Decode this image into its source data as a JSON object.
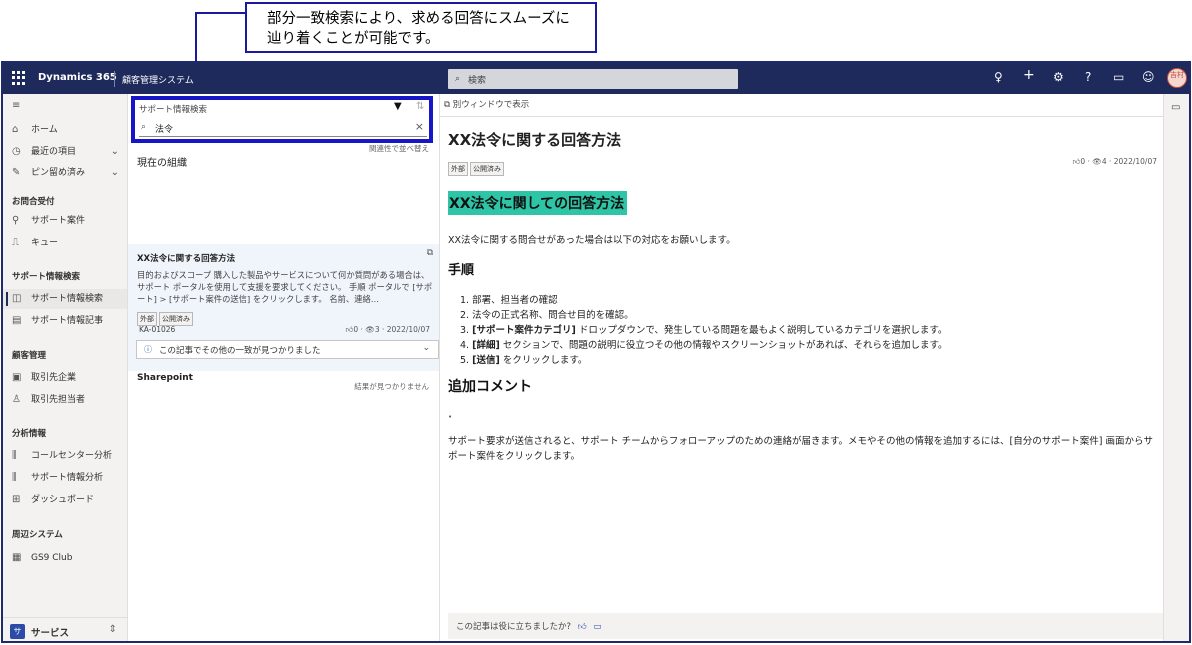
{
  "callout": {
    "line1": "部分一致検索により、求める回答にスムーズに",
    "line2": "辿り着くことが可能です。"
  },
  "topbar": {
    "brand": "Dynamics 365",
    "app_name": "顧客管理システム",
    "search_placeholder": "検索",
    "icons": [
      "lightbulb-icon",
      "plus-icon",
      "settings-icon",
      "help-icon",
      "chat-icon",
      "smiley-icon"
    ],
    "avatar_text": "吉村"
  },
  "sidebar": {
    "top_items": [
      {
        "label": "ホーム",
        "icon": "home-icon"
      },
      {
        "label": "最近の項目",
        "icon": "clock-icon"
      },
      {
        "label": "ピン留め済み",
        "icon": "pin-icon"
      }
    ],
    "groups": [
      {
        "title": "お問合受付",
        "items": [
          {
            "label": "サポート案件"
          },
          {
            "label": "キュー"
          }
        ]
      },
      {
        "title": "サポート情報検索",
        "items": [
          {
            "label": "サポート情報検索"
          },
          {
            "label": "サポート情報記事"
          }
        ]
      },
      {
        "title": "顧客管理",
        "items": [
          {
            "label": "取引先企業"
          },
          {
            "label": "取引先担当者"
          }
        ]
      },
      {
        "title": "分析情報",
        "items": [
          {
            "label": "コールセンター分析"
          },
          {
            "label": "サポート情報分析"
          },
          {
            "label": "ダッシュボード"
          }
        ]
      },
      {
        "title": "周辺システム",
        "items": [
          {
            "label": "GS9 Club"
          }
        ]
      }
    ],
    "area": {
      "badge": "サ",
      "label": "サービス"
    }
  },
  "kb": {
    "title": "サポート情報検索",
    "query": "法令",
    "org_section": "現在の組織",
    "org_right": "関連性で並べ替え",
    "result": {
      "title": "XX法令に関する回答方法",
      "body": "目的およびスコープ 購入した製品やサービスについて何か質問がある場合は、サポート ポータルを使用して支援を要求してください。 手順 ポータルで [サポート] > [サポート案件の送信] をクリックします。 名前、連絡…",
      "tags": [
        "外部",
        "公開済み"
      ],
      "id": "KA-01026",
      "likes": "0",
      "views": "3",
      "date": "2022/10/07",
      "more_matches": "この記事でその他の一致が見つかりました"
    },
    "sharepoint": {
      "title": "Sharepoint",
      "no_results": "結果が見つかりません"
    }
  },
  "article": {
    "popout": "別ウィンドウで表示",
    "title": "XX法令に関する回答方法",
    "tags": [
      "外部",
      "公開済み"
    ],
    "likes": "0",
    "views": "4",
    "date": "2022/10/07",
    "heading1": "XX法令に関しての回答方法",
    "intro": "XX法令に関する問合せがあった場合は以下の対応をお願いします。",
    "heading2": "手順",
    "steps": [
      {
        "num": "1.",
        "bold": "",
        "text": "部署、担当者の確認"
      },
      {
        "num": "2.",
        "bold": "",
        "text": "法令の正式名称、問合せ目的を確認。"
      },
      {
        "num": "3.",
        "bold": "[サポート案件カテゴリ]",
        "text": " ドロップダウンで、発生している問題を最もよく説明しているカテゴリを選択します。"
      },
      {
        "num": "4.",
        "bold": "[詳細]",
        "text": " セクションで、問題の説明に役立つその他の情報やスクリーンショットがあれば、それらを追加します。"
      },
      {
        "num": "5.",
        "bold": "[送信]",
        "text": " をクリックします。"
      }
    ],
    "heading3": "追加コメント",
    "comment": "サポート要求が送信されると、サポート チームからフォローアップのための連絡が届きます。メモやその他の情報を追加するには、[自分のサポート案件] 画面からサポート案件をクリックします。",
    "feedback": "この記事は役に立ちましたか?"
  }
}
